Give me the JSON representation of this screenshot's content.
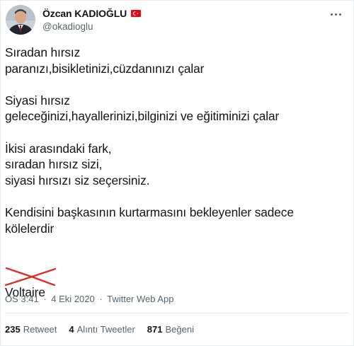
{
  "author": {
    "display_name": "Özcan KADIOĞLU",
    "handle": "@okadioglu",
    "flag_icon": "turkey-flag-icon"
  },
  "tweet": {
    "paragraphs": [
      "Sıradan hırsız\nparanızı,bisikletinizi,cüzdanınızı çalar",
      "Siyasi hırsız\ngeleceğinizi,hayallerinizi,bilginizi ve eğitiminizi çalar",
      "İkisi arasındaki fark,\nsıradan hırsız sizi,\nsiyasi hırsızı siz seçersiniz.",
      "Kendisini başkasının kurtarmasını bekleyenler sadece\nkölelerdir"
    ],
    "struck_attribution": "Voltaire",
    "strike_color": "#d93025"
  },
  "meta": {
    "time": "ÖS 3:41",
    "separator": "·",
    "date": "4 Eki 2020",
    "source": "Twitter Web App"
  },
  "stats": {
    "retweets_count": "235",
    "retweets_label": "Retweet",
    "quotes_count": "4",
    "quotes_label": "Alıntı Tweetler",
    "likes_count": "871",
    "likes_label": "Beğeni"
  },
  "colors": {
    "text_primary": "#0f1419",
    "text_secondary": "#536471",
    "divider": "#e1e8ed",
    "flag_red": "#e30a17"
  }
}
